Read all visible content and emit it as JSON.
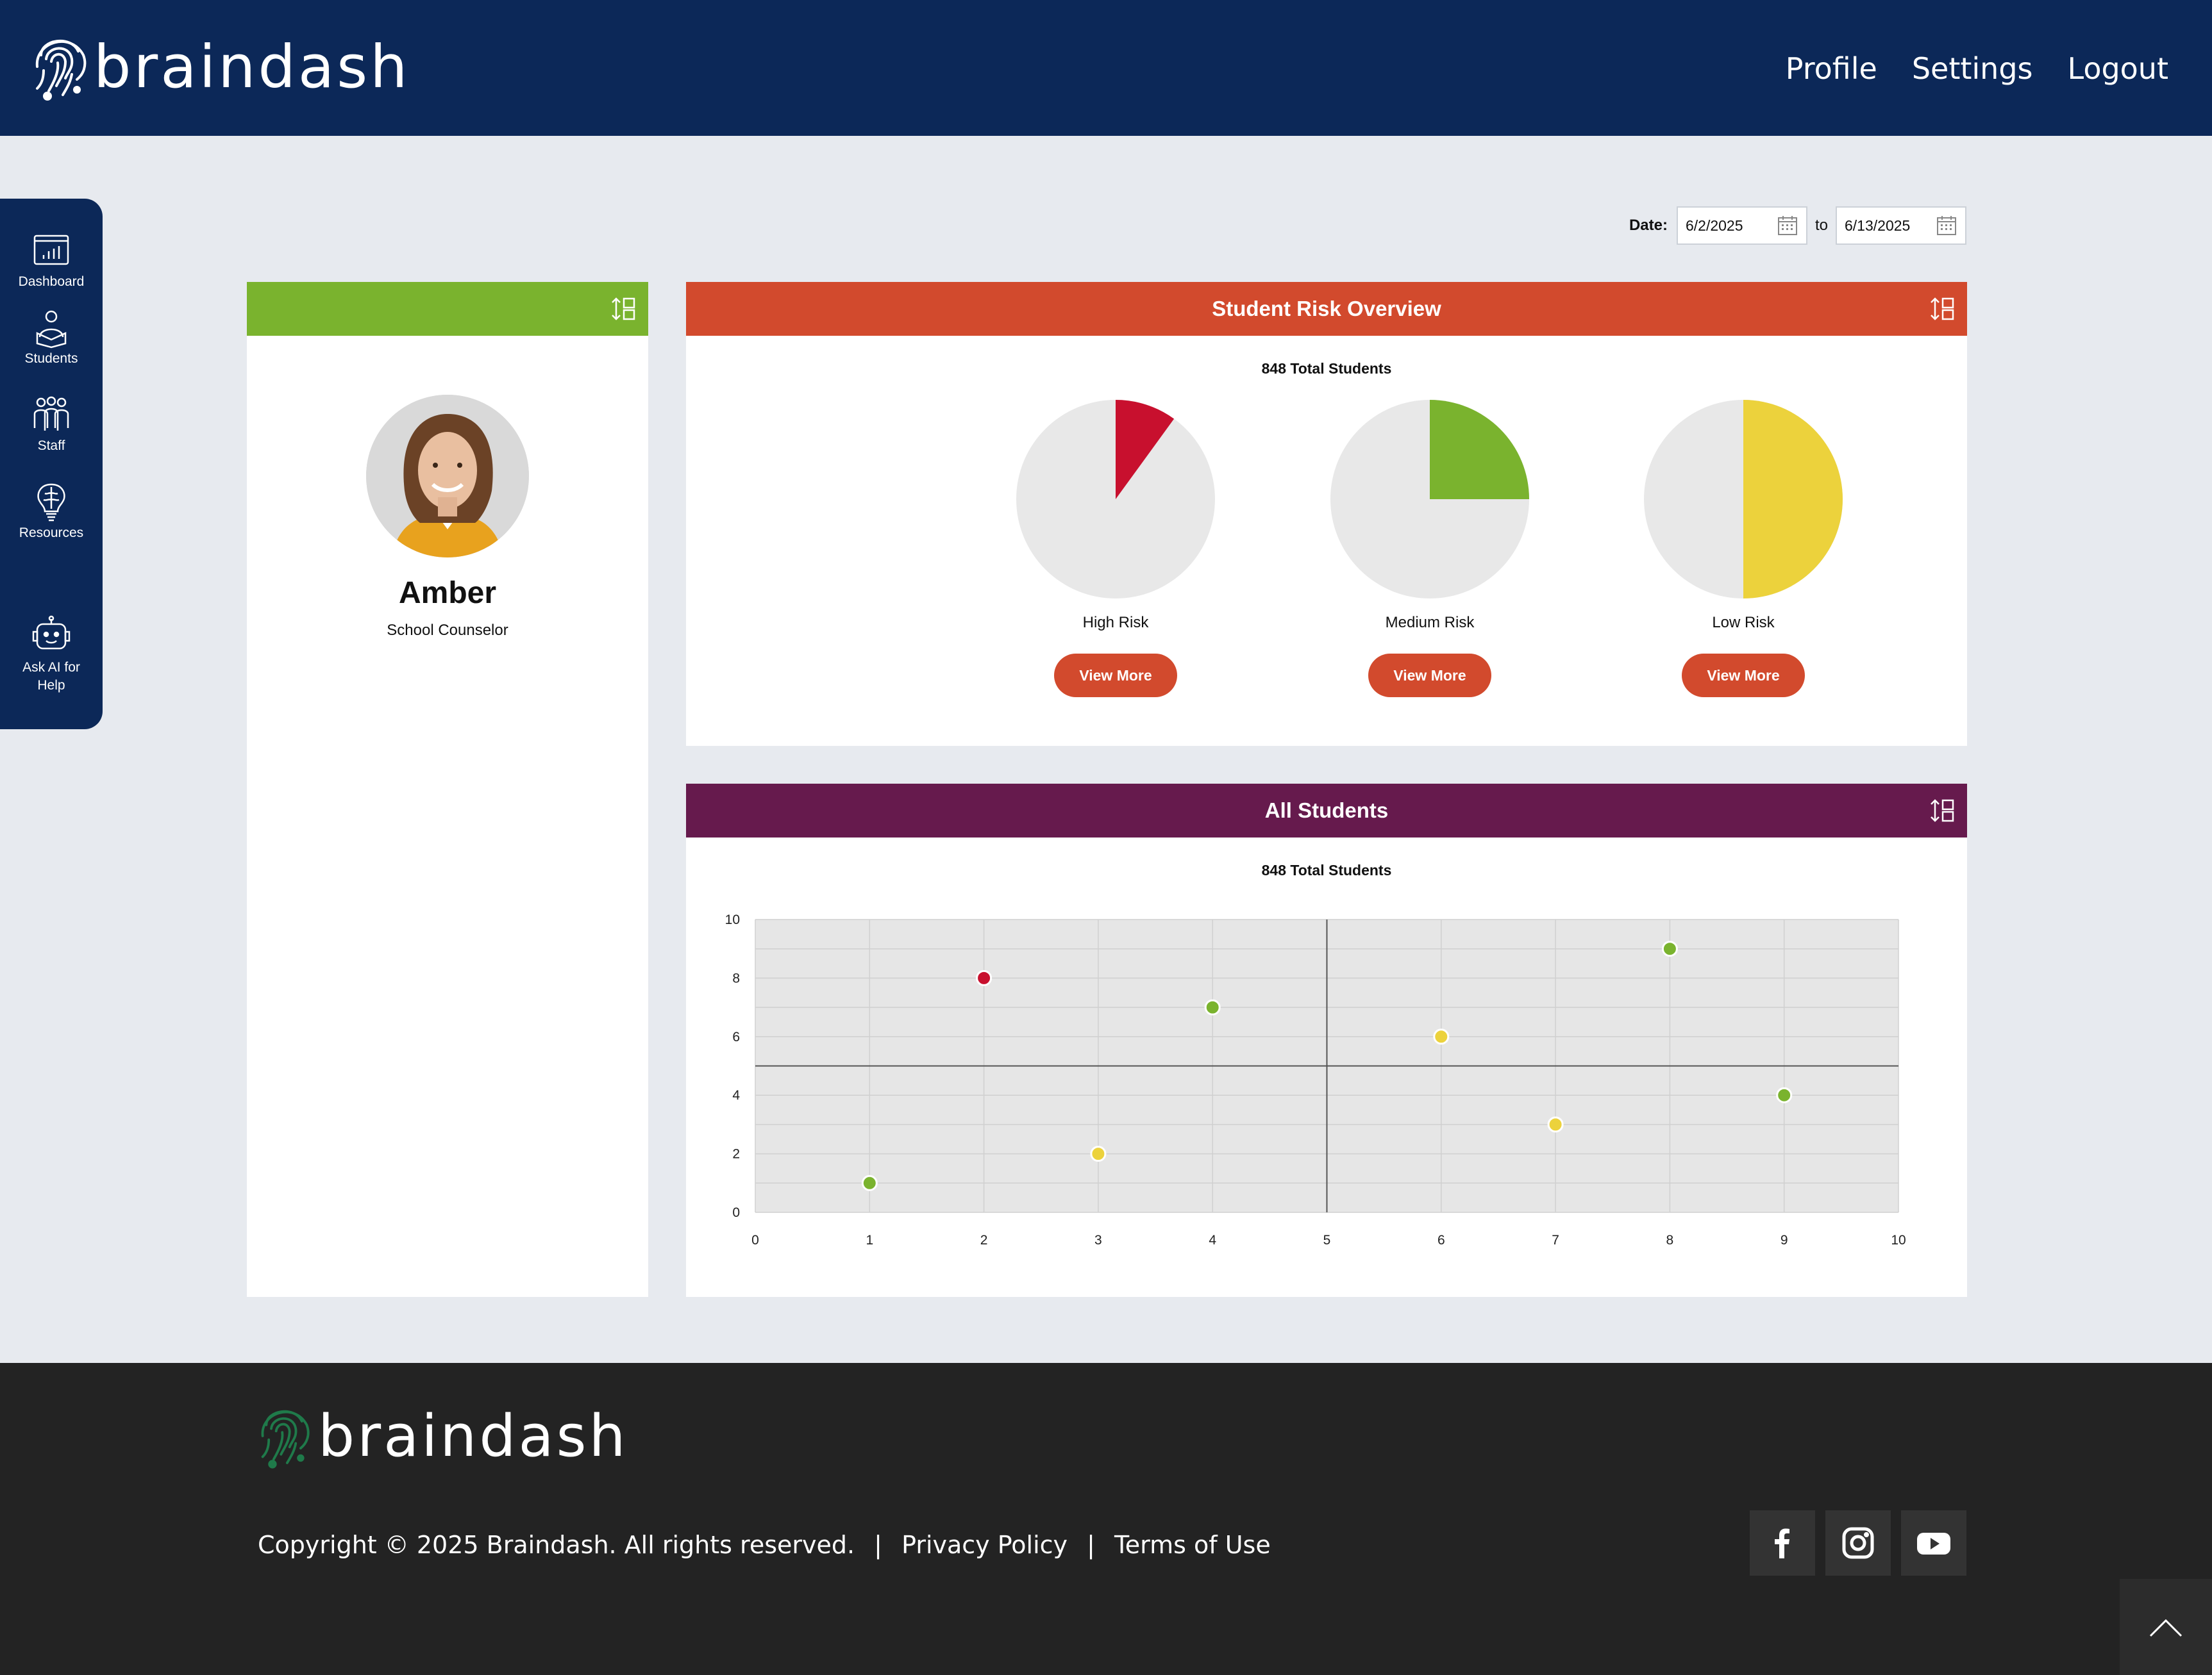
{
  "brand": {
    "name": "braindash"
  },
  "nav": {
    "profile": "Profile",
    "settings": "Settings",
    "logout": "Logout"
  },
  "sidebar": {
    "items": [
      {
        "label": "Dashboard",
        "icon": "dashboard-icon"
      },
      {
        "label": "Students",
        "icon": "students-icon"
      },
      {
        "label": "Staff",
        "icon": "staff-icon"
      },
      {
        "label": "Resources",
        "icon": "brain-bulb-icon"
      },
      {
        "label": "Ask AI for Help",
        "icon": "robot-icon"
      }
    ]
  },
  "date_range": {
    "label": "Date:",
    "from": "6/2/2025",
    "to_label": "to",
    "to": "6/13/2025"
  },
  "profile": {
    "name": "Amber",
    "role": "School Counselor"
  },
  "risk_overview": {
    "title": "Student Risk Overview",
    "total": "848 Total Students",
    "groups": [
      {
        "label": "High Risk",
        "fraction": 0.1,
        "color": "#c8102e",
        "button": "View More"
      },
      {
        "label": "Medium Risk",
        "fraction": 0.25,
        "color": "#7ab32e",
        "button": "View More"
      },
      {
        "label": "Low Risk",
        "fraction": 0.5,
        "color": "#ecd23c",
        "button": "View More"
      }
    ]
  },
  "all_students": {
    "title": "All Students",
    "total": "848 Total Students"
  },
  "chart_data": {
    "type": "scatter",
    "xlim": [
      0,
      10
    ],
    "ylim": [
      0,
      10
    ],
    "xticks": [
      0,
      1,
      2,
      3,
      4,
      5,
      6,
      7,
      8,
      9,
      10
    ],
    "yticks": [
      0,
      2,
      4,
      6,
      8,
      10
    ],
    "grid": true,
    "quadrant_lines": {
      "x": 5,
      "y": 5
    },
    "points": [
      {
        "x": 1,
        "y": 1,
        "color": "#7ab32e"
      },
      {
        "x": 2,
        "y": 8,
        "color": "#c8102e"
      },
      {
        "x": 3,
        "y": 2,
        "color": "#ecd23c"
      },
      {
        "x": 4,
        "y": 7,
        "color": "#7ab32e"
      },
      {
        "x": 6,
        "y": 6,
        "color": "#ecd23c"
      },
      {
        "x": 7,
        "y": 3,
        "color": "#ecd23c"
      },
      {
        "x": 8,
        "y": 9,
        "color": "#7ab32e"
      },
      {
        "x": 9,
        "y": 4,
        "color": "#7ab32e"
      }
    ]
  },
  "footer": {
    "copyright": "Copyright © 2025 Braindash. All rights reserved.",
    "privacy": "Privacy Policy",
    "terms": "Terms of Use",
    "separator": "|",
    "social": [
      "facebook-icon",
      "instagram-icon",
      "youtube-icon"
    ]
  }
}
